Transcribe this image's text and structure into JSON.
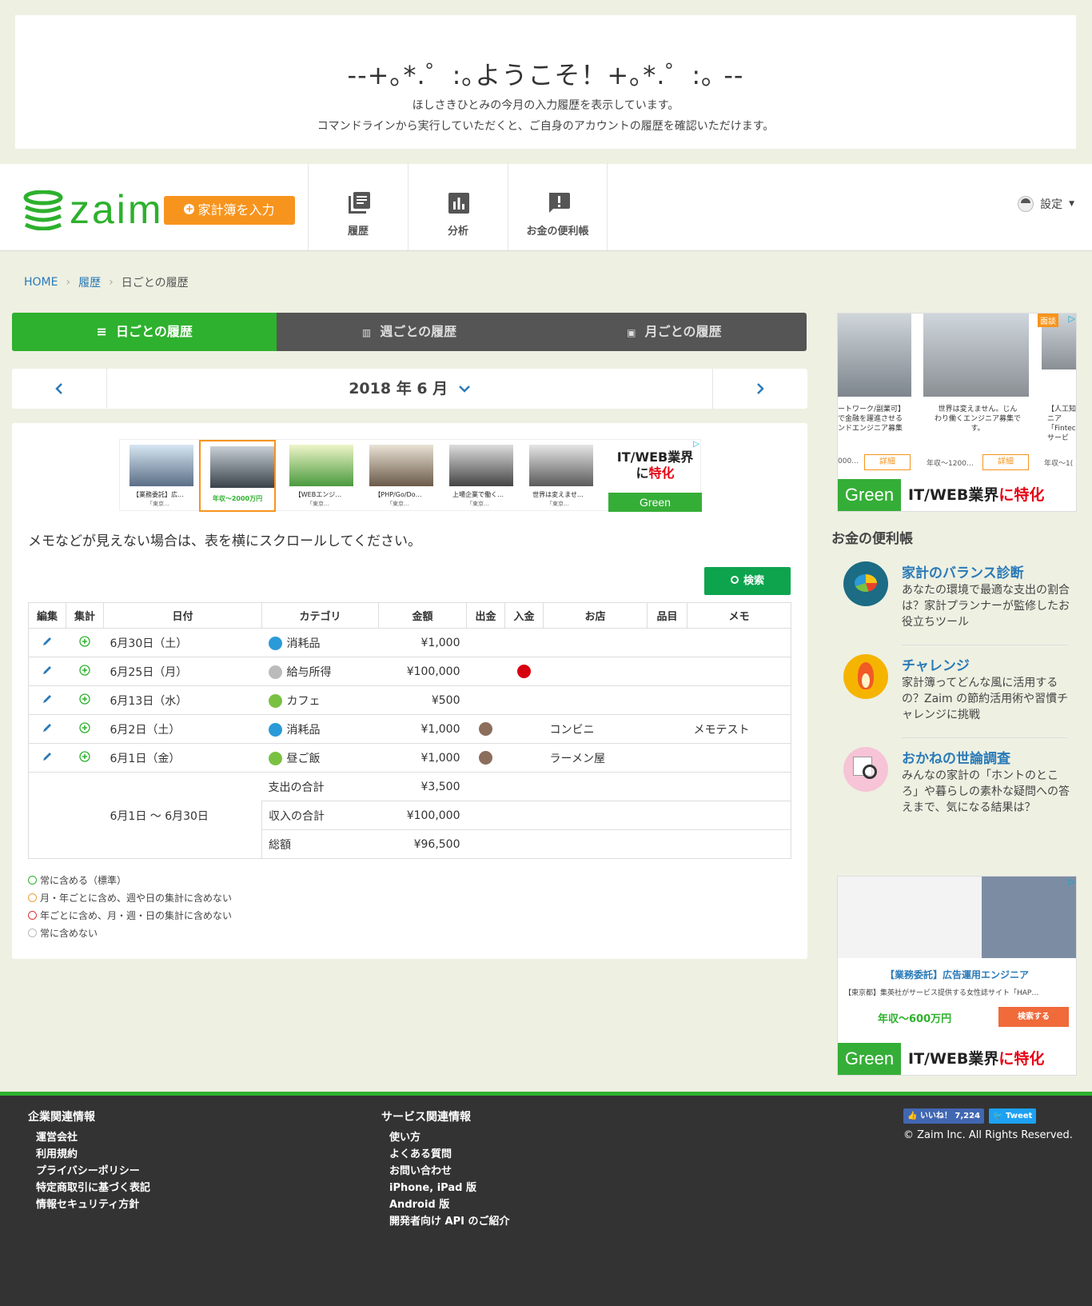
{
  "welcome": {
    "title": "--+｡*.゜:｡ようこそ！+｡*.゜:｡ --",
    "line1": "ほしさきひとみの今月の入力履歴を表示しています。",
    "line2": "コマンドラインから実行していただくと、ご自身のアカウントの履歴を確認いただけます。"
  },
  "header": {
    "logo": "zaim",
    "input_button": "家計簿を入力",
    "nav": [
      {
        "label": "履歴",
        "icon": "history-icon"
      },
      {
        "label": "分析",
        "icon": "chart-icon"
      },
      {
        "label": "お金の便利帳",
        "icon": "exclamation-icon"
      }
    ],
    "settings": "設定"
  },
  "breadcrumb": {
    "home": "HOME",
    "history": "履歴",
    "current": "日ごとの履歴"
  },
  "tabs": [
    {
      "label": "日ごとの履歴",
      "active": true
    },
    {
      "label": "週ごとの履歴",
      "active": false
    },
    {
      "label": "月ごとの履歴",
      "active": false
    }
  ],
  "month_nav": {
    "title": "2018 年 6 月"
  },
  "ad_top": {
    "items": [
      {
        "caption": "【業務委託】広…",
        "sub": "「東京…"
      },
      {
        "caption": "年収〜2000万円",
        "sub": ""
      },
      {
        "caption": "【WEBエンジ…",
        "sub": "「東京…"
      },
      {
        "caption": "【PHP/Go/Do…",
        "sub": "「東京…"
      },
      {
        "caption": "上場企業で働く…",
        "sub": "「東京…"
      },
      {
        "caption": "世界は変えませ…",
        "sub": "「東京…"
      }
    ],
    "brand_line1": "IT/WEB業界",
    "brand_line2a": "に",
    "brand_line2b": "特化",
    "brand_logo": "Green"
  },
  "memo_note": "メモなどが見えない場合は、表を横にスクロールしてください。",
  "search_button": "検索",
  "table": {
    "headers": [
      "編集",
      "集計",
      "日付",
      "カテゴリ",
      "金額",
      "出金",
      "入金",
      "お店",
      "品目",
      "メモ"
    ],
    "rows": [
      {
        "date": "6月30日（土）",
        "category": "消耗品",
        "amount": "¥1,000",
        "shop": "",
        "memo": ""
      },
      {
        "date": "6月25日（月）",
        "category": "給与所得",
        "amount": "¥100,000",
        "shop": "",
        "memo": ""
      },
      {
        "date": "6月13日（水）",
        "category": "カフェ",
        "amount": "¥500",
        "shop": "",
        "memo": ""
      },
      {
        "date": "6月2日（土）",
        "category": "消耗品",
        "amount": "¥1,000",
        "shop": "コンビニ",
        "memo": "メモテスト"
      },
      {
        "date": "6月1日（金）",
        "category": "昼ご飯",
        "amount": "¥1,000",
        "shop": "ラーメン屋",
        "memo": ""
      }
    ],
    "range": "6月1日 〜 6月30日",
    "totals": [
      {
        "label": "支出の合計",
        "value": "¥3,500"
      },
      {
        "label": "収入の合計",
        "value": "¥100,000"
      },
      {
        "label": "総額",
        "value": "¥96,500"
      }
    ]
  },
  "legend": [
    "常に含める（標準）",
    "月・年ごとに含め、週や日の集計に含めない",
    "年ごとに含め、月・週・日の集計に含めない",
    "常に含めない"
  ],
  "side_ad1": {
    "badge": "面談",
    "cap1": "ートワーク/副業可】",
    "cap1b": "で金融を躍進させる",
    "cap1c": "ンドエンジニア募集",
    "cap2": "世界は変えません。じん",
    "cap2b": "わり働くエンジニア募集で",
    "cap2c": "す。",
    "cap3": "【人工知",
    "cap3b": "ニア",
    "cap3c": "「Fintec",
    "cap3d": "サービ",
    "salary1": "000…",
    "salary2": "年収〜1200…",
    "salary3": "年収〜1(",
    "detail": "詳細",
    "brand": "IT/WEB業界",
    "brand_red": "に特化",
    "logo": "Green"
  },
  "side_heading": "お金の便利帳",
  "side_items": [
    {
      "title": "家計のバランス診断",
      "desc": "あなたの環境で最適な支出の割合は？家計プランナーが監修したお役立ちツール"
    },
    {
      "title": "チャレンジ",
      "desc": "家計簿ってどんな風に活用するの？Zaim の節約活用術や習慣チャレンジに挑戦"
    },
    {
      "title": "おかねの世論調査",
      "desc": "みんなの家計の「ホントのところ」や暮らしの素朴な疑問への答えまで、気になる結果は？"
    }
  ],
  "side_ad2": {
    "title": "【業務委託】広告運用エンジニア",
    "sub": "【東京都】集英社がサービス提供する女性誌サイト「HAP…",
    "salary": "年収〜600万円",
    "button": "検索する",
    "brand": "IT/WEB業界",
    "brand_red": "に特化",
    "logo": "Green"
  },
  "footer": {
    "col1_heading": "企業関連情報",
    "col1": [
      "運営会社",
      "利用規約",
      "プライバシーポリシー",
      "特定商取引に基づく表記",
      "情報セキュリティ方針"
    ],
    "col2_heading": "サービス関連情報",
    "col2": [
      "使い方",
      "よくある質問",
      "お問い合わせ",
      "iPhone, iPad 版",
      "Android 版",
      "開発者向け API のご紹介"
    ],
    "like": "いいね！ 7,224",
    "tweet": "Tweet",
    "copyright": "© Zaim Inc. All Rights Reserved."
  },
  "colors": {
    "brand_green": "#2eb12e",
    "accent_orange": "#f7941d",
    "link_blue": "#2a7ab8",
    "search_green": "#0ea44e"
  }
}
